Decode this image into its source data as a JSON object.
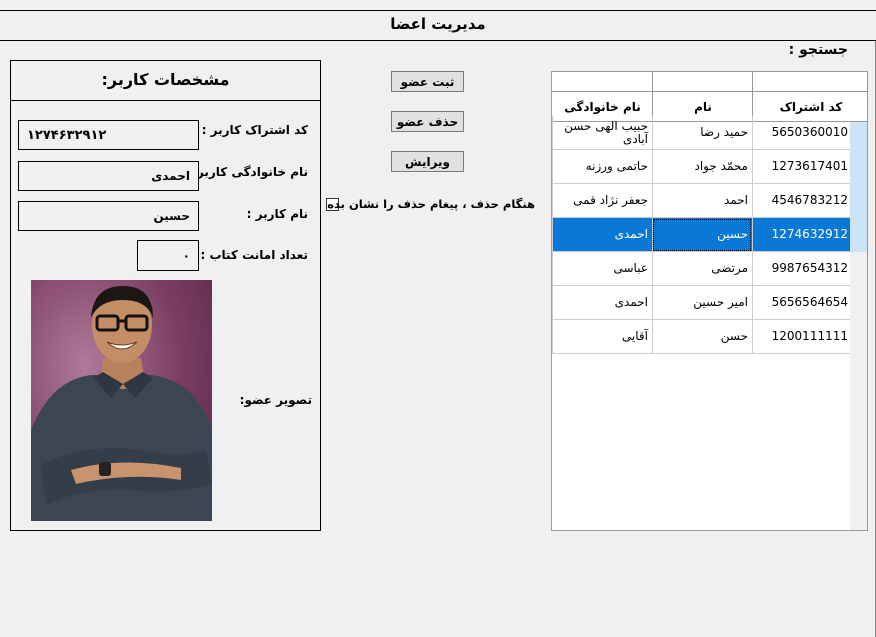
{
  "window": {
    "title": "مدیریت اعضا"
  },
  "search": {
    "label": "جستجو :"
  },
  "details": {
    "title": "مشخصات کاربر:",
    "membership_code_label": "کد اشتراک کاربر :",
    "membership_code_value": "۱۲۷۴۶۳۲۹۱۲",
    "last_name_label": "نام خانوادگی کاربر :",
    "last_name_value": "احمدی",
    "first_name_label": "نام کاربر :",
    "first_name_value": "حسین",
    "loans_label": "تعداد امانت کتاب :",
    "loans_value": "۰",
    "photo_label": "تصویر عضو:"
  },
  "actions": {
    "register_label": "ثبت عضو",
    "delete_label": "حذف عضو",
    "edit_label": "ویرایش",
    "confirm_delete_label": "هنگام حذف ، پیغام حذف را نشان بده",
    "confirm_delete_checked": false
  },
  "grid": {
    "columns": [
      "کد اشتراک",
      "نام",
      "نام خانوادگی"
    ],
    "rows": [
      {
        "index": "1",
        "code": "5650360010",
        "first": "حمید رضا",
        "last": "حبیب الهی حسن آبادی"
      },
      {
        "index": "2",
        "code": "1273617401",
        "first": "محمّد جواد",
        "last": "حاتمی ورزنه"
      },
      {
        "index": "3",
        "code": "4546783212",
        "first": "احمد",
        "last": "جعفر نژاد قمی"
      },
      {
        "index": "4",
        "code": "1274632912",
        "first": "حسین",
        "last": "احمدی"
      },
      {
        "index": "5",
        "code": "9987654312",
        "first": "مرتضی",
        "last": "عباسی"
      },
      {
        "index": "6",
        "code": "5656564654",
        "first": "امیر حسین",
        "last": "احمدی"
      },
      {
        "index": "7",
        "code": "1200111111",
        "first": "حسن",
        "last": "آقایی"
      }
    ],
    "selected_index": "4"
  },
  "colors": {
    "selection": "#0a78d7",
    "background": "#f0f0f0"
  }
}
